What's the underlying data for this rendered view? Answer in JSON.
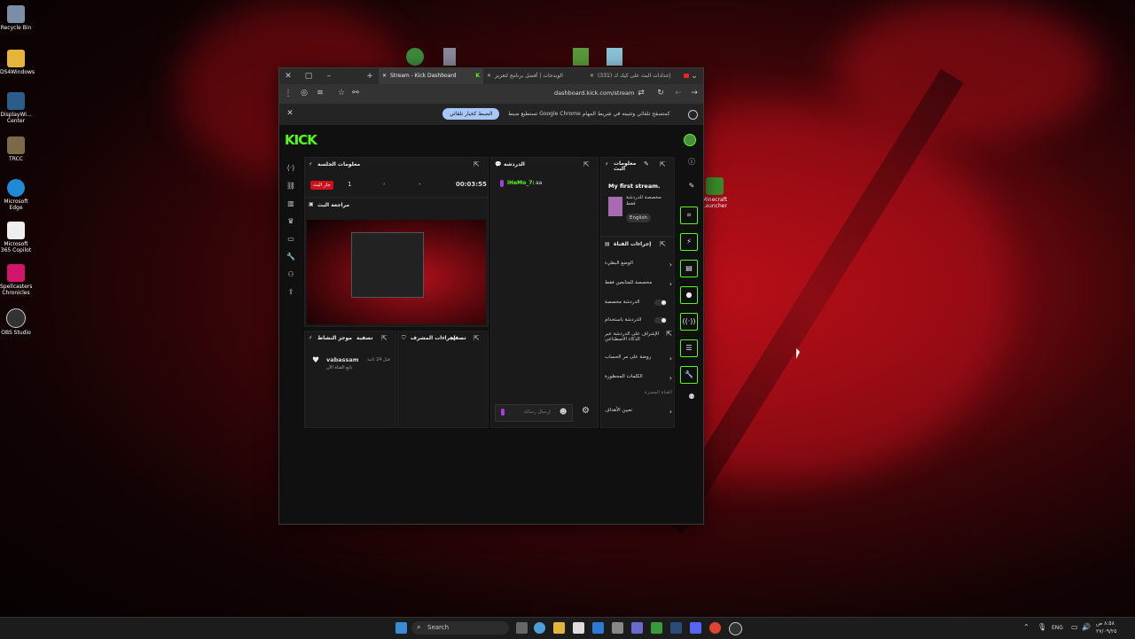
{
  "desktop": {
    "icons": [
      {
        "label": "Recycle Bin"
      },
      {
        "label": "DS4Windows"
      },
      {
        "label": "DisplayWi... Center"
      },
      {
        "label": "TRCC"
      },
      {
        "label": "Microsoft Edge"
      },
      {
        "label": "Microsoft 365 Copilot"
      },
      {
        "label": "Spellcasters Chronicles"
      },
      {
        "label": "OBS Studio"
      }
    ],
    "minecraft_label": "Minecraft Launcher"
  },
  "browser": {
    "tabs": [
      {
        "label": "Stream - Kick Dashboard"
      },
      {
        "label": "الوبدجات | أفضل برنامج لتعزيز"
      },
      {
        "label": "(331) إعدادات البث على كيك ك"
      }
    ],
    "url": "dashboard.kick.com/stream",
    "notice_message": "تستطيع ضبط Google Chrome كمتصفح تلقائي وتثبيته في شريط المهام",
    "notice_button": "الضبط كخيار تلقائي"
  },
  "dashboard": {
    "logo": "KICK",
    "session": {
      "title": "معلومات الجلسة",
      "live_badge": "جار البث",
      "viewers": "1",
      "followers": "-",
      "subs": "-",
      "duration": "00:03:55"
    },
    "preview_title": "مراجعة البث",
    "activity": {
      "title": "موجز النشاط",
      "filter": "تصفية",
      "user": "vabassam",
      "desc": "تابع القناة الآن",
      "time": "قبل 24 ثانية"
    },
    "mod": {
      "title": "إجراءات المشرف",
      "filter": "تصفية"
    },
    "chat": {
      "title": "الدردشة",
      "username": "iHeMo_7:",
      "message": "aa",
      "placeholder": "إرسال رسالة"
    },
    "stream_info": {
      "title": "معلومات البث",
      "stream_title": "My first stream.",
      "category": "مخصصة للدردشة فقط",
      "language": "English"
    },
    "channel_actions": {
      "title": "إجراءات القناة",
      "rows": [
        {
          "label": "الوضع البطيء"
        },
        {
          "label": "مخصصة للمتابعين فقط"
        },
        {
          "label": "الدردشة مخصصة"
        },
        {
          "label": "الدردشة باستخدام"
        },
        {
          "label": "الإشراف على الدردشة عبر الذكاء الاصطناعي"
        },
        {
          "label": "روضة على مر الحساب"
        },
        {
          "label": "الكلمات المحظورة"
        },
        {
          "label": "القناة المميزة"
        },
        {
          "label": "تعيين الأهداف"
        }
      ]
    }
  },
  "taskbar": {
    "search": "Search",
    "lang": "ENG",
    "time": "٨:٥٨ ص",
    "date": "٢٧/٠٩/٢٥"
  }
}
